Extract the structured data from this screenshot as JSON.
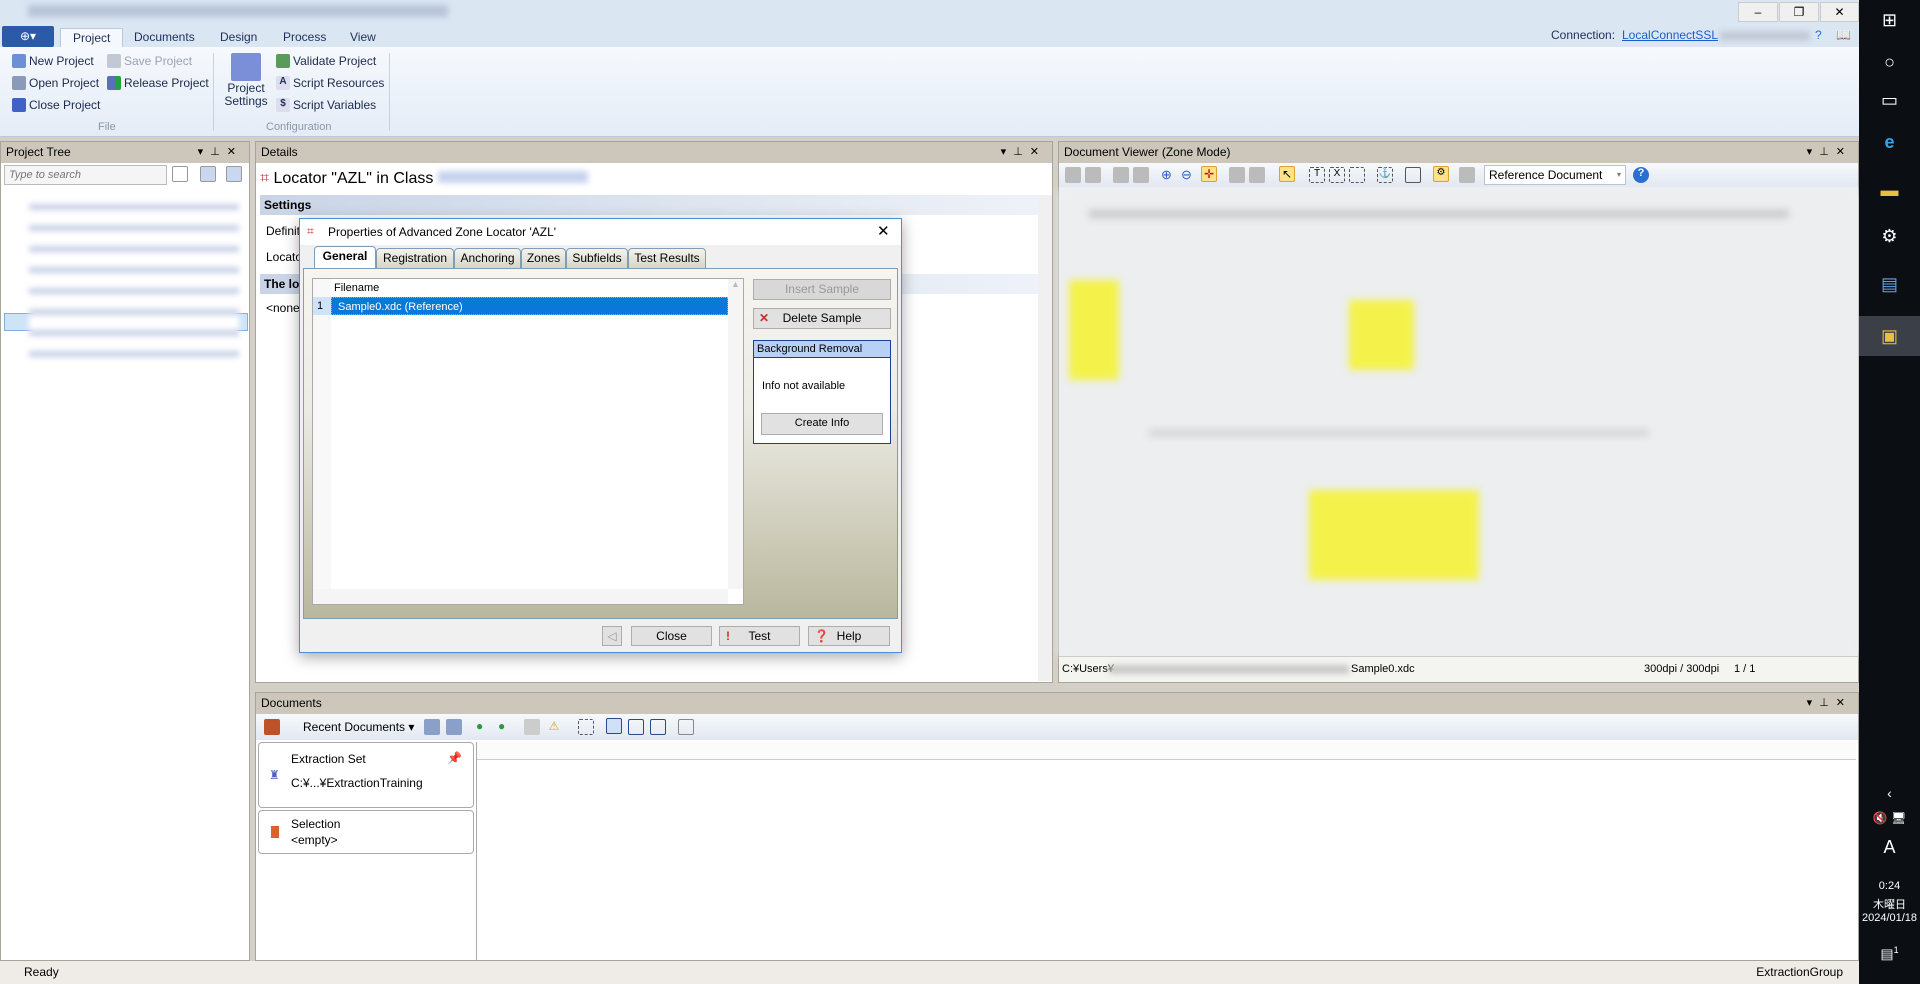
{
  "ribbon": {
    "tabs": [
      "Project",
      "Documents",
      "Design",
      "Process",
      "View"
    ],
    "file": {
      "new": "New Project",
      "open": "Open Project",
      "close": "Close Project",
      "save": "Save Project",
      "release": "Release Project",
      "group": "File"
    },
    "config": {
      "settings": "Project Settings",
      "validate": "Validate Project",
      "resources": "Script Resources",
      "variables": "Script Variables",
      "group": "Configuration"
    },
    "connection_label": "Connection:",
    "connection_value": "LocalConnectSSL"
  },
  "project_tree": {
    "title": "Project Tree",
    "search_placeholder": "Type to search"
  },
  "details": {
    "title": "Details",
    "heading": "Locator \"AZL\" in Class",
    "settings": "Settings",
    "row1": "Definit",
    "row2": "Locato",
    "section": "The loc",
    "value": "<none"
  },
  "dialog": {
    "title": "Properties of Advanced Zone Locator 'AZL'",
    "tabs": [
      "General",
      "Registration",
      "Anchoring",
      "Zones",
      "Subfields",
      "Test Results"
    ],
    "list_header": "Filename",
    "rows": [
      {
        "index": "1",
        "filename": "Sample0.xdc (Reference)"
      }
    ],
    "insert": "Insert Sample",
    "delete": "Delete Sample",
    "bg_title": "Background Removal",
    "bg_info": "Info not available",
    "create_info": "Create Info",
    "close": "Close",
    "test": "Test",
    "help": "Help"
  },
  "viewer": {
    "title": "Document Viewer (Zone Mode)",
    "dropdown": "Reference Document",
    "path_start": "C:¥Users¥",
    "file": "Sample0.xdc",
    "dpi": "300dpi / 300dpi",
    "page": "1 / 1"
  },
  "documents": {
    "title": "Documents",
    "recent": "Recent Documents",
    "cards": [
      {
        "title": "Extraction Set",
        "sub": "C:¥...¥ExtractionTraining"
      },
      {
        "title": "Selection",
        "sub": "<empty>"
      }
    ]
  },
  "status": {
    "left": "Ready",
    "right": "ExtractionGroup"
  },
  "taskbar": {
    "ime": "A",
    "time": "0:24",
    "day": "木曜日",
    "date": "2024/01/18",
    "notifications": "1"
  }
}
